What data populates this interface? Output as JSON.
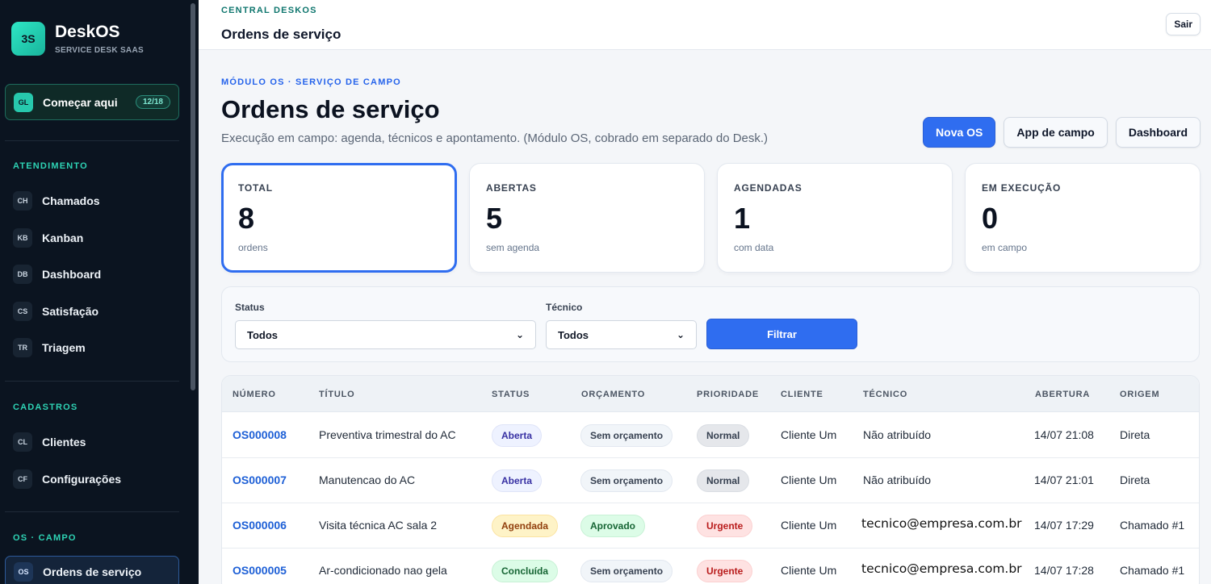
{
  "brand": {
    "logo": "3S",
    "name": "DeskOS",
    "subtitle": "SERVICE DESK SAAS"
  },
  "start": {
    "chip": "GL",
    "label": "Começar aqui",
    "count": "12/18"
  },
  "sidebar": {
    "sections": [
      {
        "title": "ATENDIMENTO",
        "items": [
          {
            "chip": "CH",
            "label": "Chamados"
          },
          {
            "chip": "KB",
            "label": "Kanban"
          },
          {
            "chip": "DB",
            "label": "Dashboard"
          },
          {
            "chip": "CS",
            "label": "Satisfação"
          },
          {
            "chip": "TR",
            "label": "Triagem"
          }
        ]
      },
      {
        "title": "CADASTROS",
        "items": [
          {
            "chip": "CL",
            "label": "Clientes"
          },
          {
            "chip": "CF",
            "label": "Configurações"
          }
        ]
      },
      {
        "title": "OS · CAMPO",
        "items": [
          {
            "chip": "OS",
            "label": "Ordens de serviço",
            "active": true
          }
        ]
      }
    ]
  },
  "topbar": {
    "kicker": "CENTRAL DESKOS",
    "title": "Ordens de serviço",
    "logout": "Sair"
  },
  "page": {
    "kicker": "MÓDULO OS · SERVIÇO DE CAMPO",
    "title": "Ordens de serviço",
    "subtitle": "Execução em campo: agenda, técnicos e apontamento. (Módulo OS, cobrado em separado do Desk.)",
    "actions": [
      "Nova OS",
      "App de campo",
      "Dashboard"
    ]
  },
  "stats": [
    {
      "label": "TOTAL",
      "value": "8",
      "caption": "ordens",
      "selected": true
    },
    {
      "label": "ABERTAS",
      "value": "5",
      "caption": "sem agenda"
    },
    {
      "label": "AGENDADAS",
      "value": "1",
      "caption": "com data"
    },
    {
      "label": "EM EXECUÇÃO",
      "value": "0",
      "caption": "em campo"
    }
  ],
  "filters": {
    "status_label": "Status",
    "status_value": "Todos",
    "tech_label": "Técnico",
    "tech_value": "Todos",
    "submit": "Filtrar"
  },
  "table": {
    "headers": [
      "NÚMERO",
      "TÍTULO",
      "STATUS",
      "ORÇAMENTO",
      "PRIORIDADE",
      "CLIENTE",
      "TÉCNICO",
      "ABERTURA",
      "ORIGEM"
    ],
    "rows": [
      {
        "numero": "OS000008",
        "titulo": "Preventiva trimestral do AC",
        "status": "Aberta",
        "orcamento": "Sem orçamento",
        "prioridade": "Normal",
        "cliente": "Cliente Um",
        "tecnico": "Não atribuído",
        "abertura": "14/07 21:08",
        "origem": "Direta"
      },
      {
        "numero": "OS000007",
        "titulo": "Manutencao do AC",
        "status": "Aberta",
        "orcamento": "Sem orçamento",
        "prioridade": "Normal",
        "cliente": "Cliente Um",
        "tecnico": "Não atribuído",
        "abertura": "14/07 21:01",
        "origem": "Direta"
      },
      {
        "numero": "OS000006",
        "titulo": "Visita técnica AC sala 2",
        "status": "Agendada",
        "orcamento": "Aprovado",
        "prioridade": "Urgente",
        "cliente": "Cliente Um",
        "tecnico": "tecnico@empresa.com.br",
        "abertura": "14/07 17:29",
        "origem": "Chamado #1"
      },
      {
        "numero": "OS000005",
        "titulo": "Ar-condicionado nao gela",
        "status": "Concluída",
        "orcamento": "Sem orçamento",
        "prioridade": "Urgente",
        "cliente": "Cliente Um",
        "tecnico": "tecnico@empresa.com.br",
        "abertura": "14/07 17:28",
        "origem": "Chamado #1"
      }
    ]
  }
}
